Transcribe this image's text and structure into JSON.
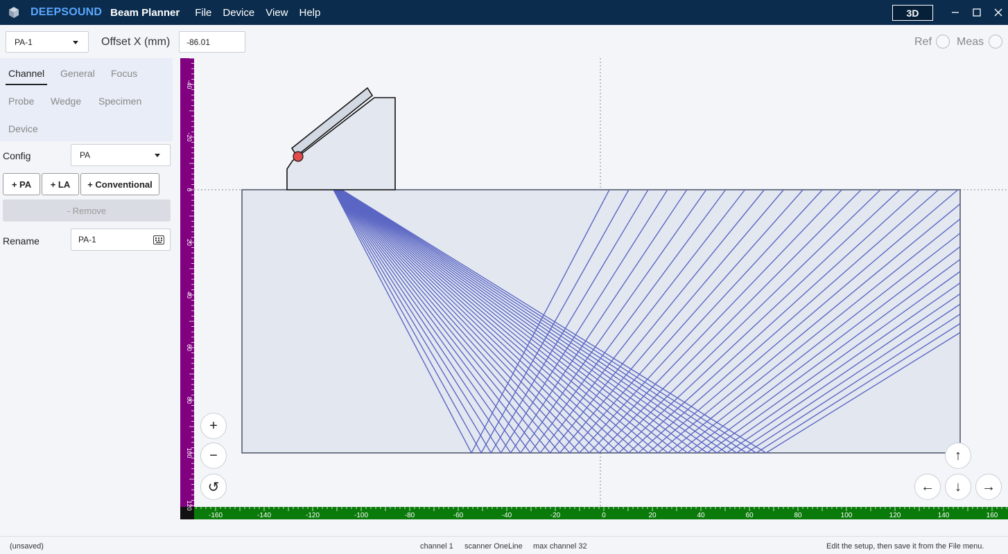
{
  "titlebar": {
    "brand": "DEEPSOUND",
    "app_name": "Beam Planner",
    "menu": [
      "File",
      "Device",
      "View",
      "Help"
    ],
    "view_3d_label": "3D",
    "logo_icon": "cube-icon",
    "window_controls": [
      "minimize-icon",
      "maximize-icon",
      "close-icon"
    ]
  },
  "toolbar": {
    "channel_select": "PA-1",
    "offset_label": "Offset X (mm)",
    "offset_value": "-86.01",
    "ref_label": "Ref",
    "meas_label": "Meas"
  },
  "sidebar": {
    "tabs": [
      "Channel",
      "General",
      "Focus",
      "Probe",
      "Wedge",
      "Specimen",
      "Device"
    ],
    "active_tab": "Channel",
    "config_label": "Config",
    "config_value": "PA",
    "add_pa": "+ PA",
    "add_la": "+ LA",
    "add_conventional": "+ Conventional",
    "remove": "- Remove",
    "rename_label": "Rename",
    "rename_value": "PA-1"
  },
  "canvas": {
    "zoom_in": "+",
    "zoom_out": "−",
    "reset": "↺",
    "pan_up": "↑",
    "pan_down": "↓",
    "pan_left": "←",
    "pan_right": "→",
    "x_ticks": [
      "-160",
      "-140",
      "-120",
      "-100",
      "-80",
      "-60",
      "-40",
      "-20",
      "0",
      "20",
      "40",
      "60",
      "80",
      "100",
      "120",
      "140",
      "160"
    ],
    "y_ticks": [
      "-40",
      "-20",
      "0",
      "20",
      "40",
      "60",
      "80",
      "100",
      "120"
    ],
    "colors": {
      "beam": "#5b66c4",
      "ruler_x": "#0a7a0a",
      "ruler_y": "#800080",
      "specimen": "#e3e8f0"
    }
  },
  "status": {
    "file": "(unsaved)",
    "channel": "channel 1",
    "scanner": "scanner OneLine",
    "max_channel": "max channel 32",
    "hint": "Edit the setup, then save it from the File menu."
  }
}
